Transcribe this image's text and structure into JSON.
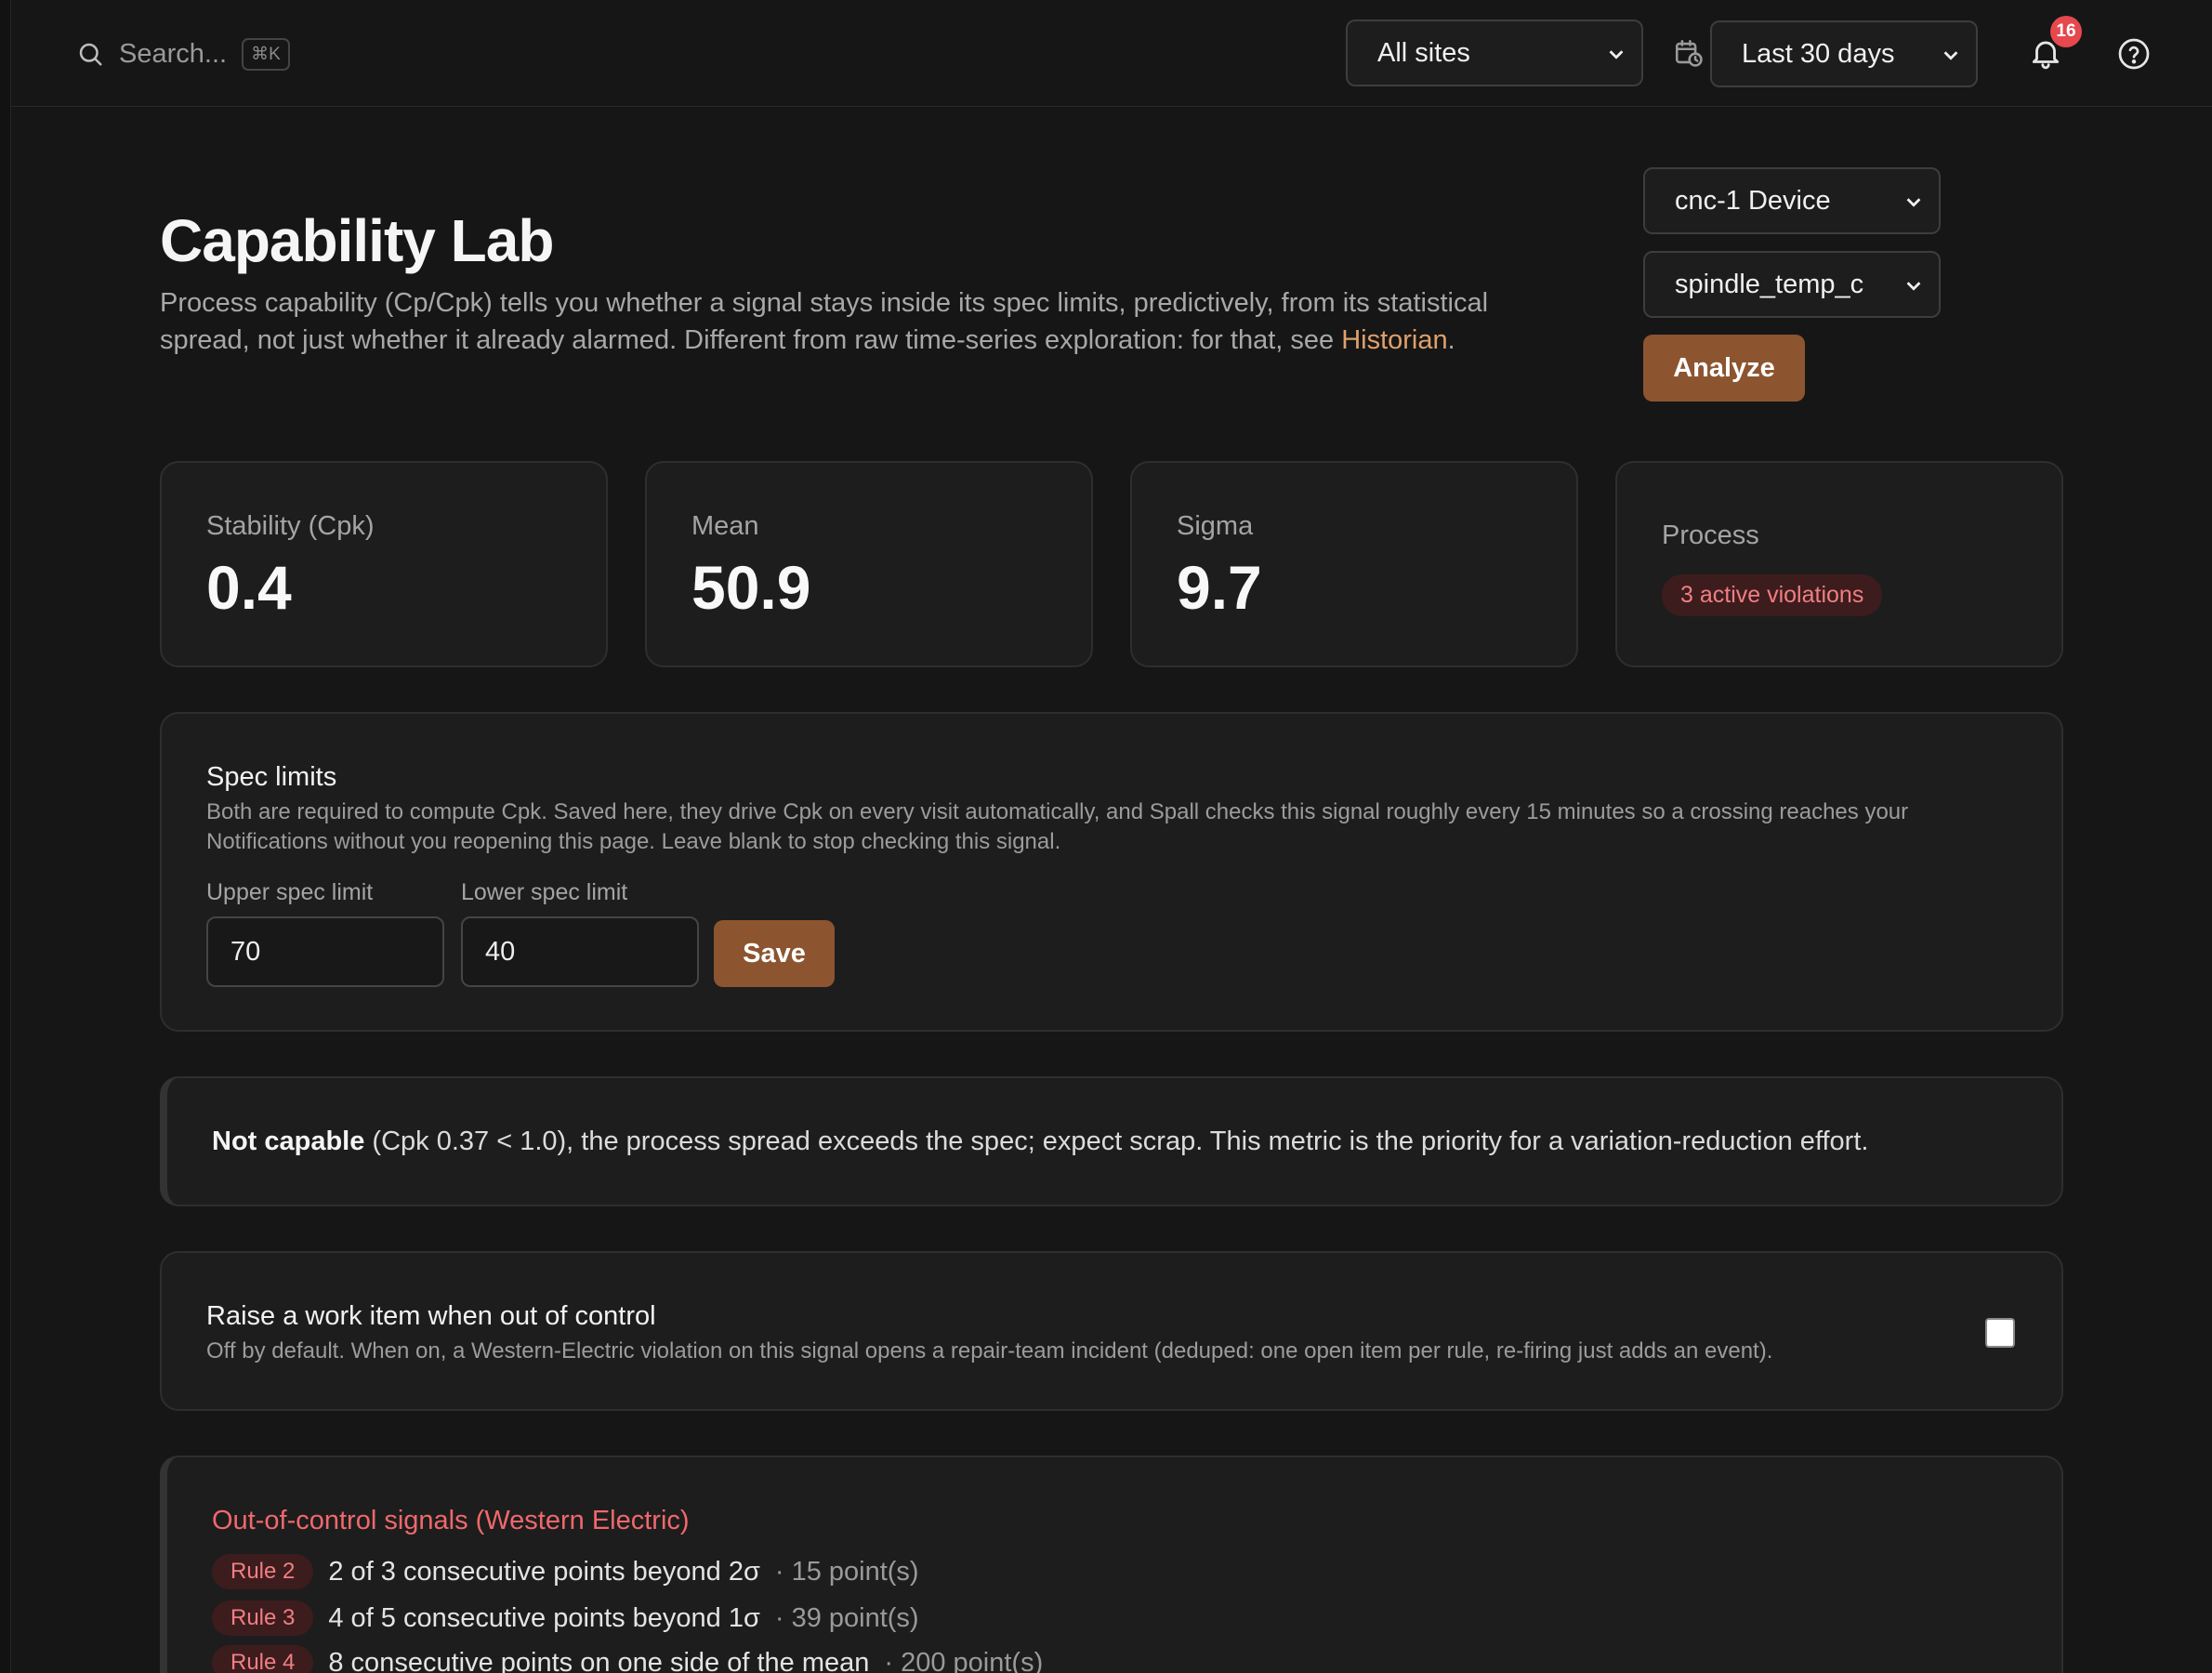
{
  "topbar": {
    "search_placeholder": "Search...",
    "search_shortcut": "⌘K",
    "site_filter": "All sites",
    "date_range": "Last 30 days",
    "notification_count": "16"
  },
  "header": {
    "title": "Capability Lab",
    "description": "Process capability (Cp/Cpk) tells you whether a signal stays inside its spec limits, predictively, from its statistical spread, not just whether it already alarmed. Different from raw time-series exploration: for that, see ",
    "description_link": "Historian",
    "description_end": ".",
    "device_select": "cnc-1 Device",
    "signal_select": "spindle_temp_c",
    "analyze_label": "Analyze"
  },
  "stats": [
    {
      "label": "Stability (Cpk)",
      "value": "0.4"
    },
    {
      "label": "Mean",
      "value": "50.9"
    },
    {
      "label": "Sigma",
      "value": "9.7"
    },
    {
      "label": "Process",
      "badge": "3 active violations"
    }
  ],
  "spec_limits": {
    "title": "Spec limits",
    "description": "Both are required to compute Cpk. Saved here, they drive Cpk on every visit automatically, and Spall checks this signal roughly every 15 minutes so a crossing reaches your Notifications without you reopening this page. Leave blank to stop checking this signal.",
    "usl_label": "Upper spec limit",
    "usl_value": "70",
    "lsl_label": "Lower spec limit",
    "lsl_value": "40",
    "save_label": "Save"
  },
  "verdict": {
    "strong": "Not capable",
    "text": " (Cpk 0.37 < 1.0), the process spread exceeds the spec; expect scrap. This metric is the priority for a variation-reduction effort."
  },
  "work_item": {
    "title": "Raise a work item when out of control",
    "description": "Off by default. When on, a Western-Electric violation on this signal opens a repair-team incident (deduped: one open item per rule, re-firing just adds an event).",
    "checked": false
  },
  "violations": {
    "title": "Out-of-control signals (Western Electric)",
    "rules": [
      {
        "rule": "Rule 2",
        "text": "2 of 3 consecutive points beyond 2σ",
        "count": "· 15 point(s)"
      },
      {
        "rule": "Rule 3",
        "text": "4 of 5 consecutive points beyond 1σ",
        "count": "· 39 point(s)"
      },
      {
        "rule": "Rule 4",
        "text": "8 consecutive points on one side of the mean",
        "count": "· 200 point(s)"
      }
    ]
  }
}
